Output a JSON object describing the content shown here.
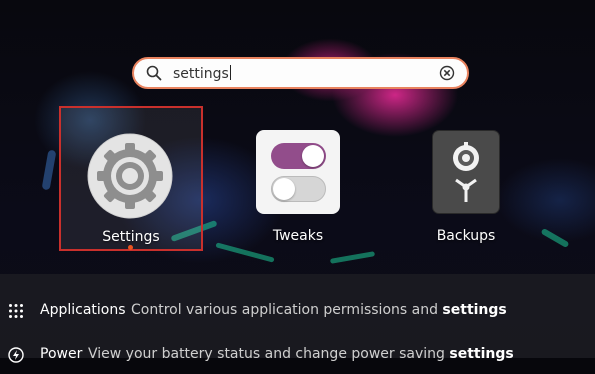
{
  "search": {
    "value": "settings",
    "icon": "search-icon",
    "clear_icon": "clear-icon"
  },
  "apps": [
    {
      "label": "Settings",
      "icon": "gear-icon",
      "selected": true
    },
    {
      "label": "Tweaks",
      "icon": "toggle-switches-icon"
    },
    {
      "label": "Backups",
      "icon": "safe-icon"
    }
  ],
  "results": [
    {
      "name": "Applications",
      "icon": "app-grid-icon",
      "desc_before": "Control various application permissions and ",
      "desc_bold": "settings"
    },
    {
      "name": "Power",
      "icon": "power-icon",
      "desc_before": "View your battery status and change power saving ",
      "desc_bold": "settings"
    }
  ],
  "colors": {
    "search_border": "#e9835f",
    "selection_border": "#c9302c",
    "running_dot": "#e95420",
    "tweaks_toggle_on": "#924d8b"
  }
}
